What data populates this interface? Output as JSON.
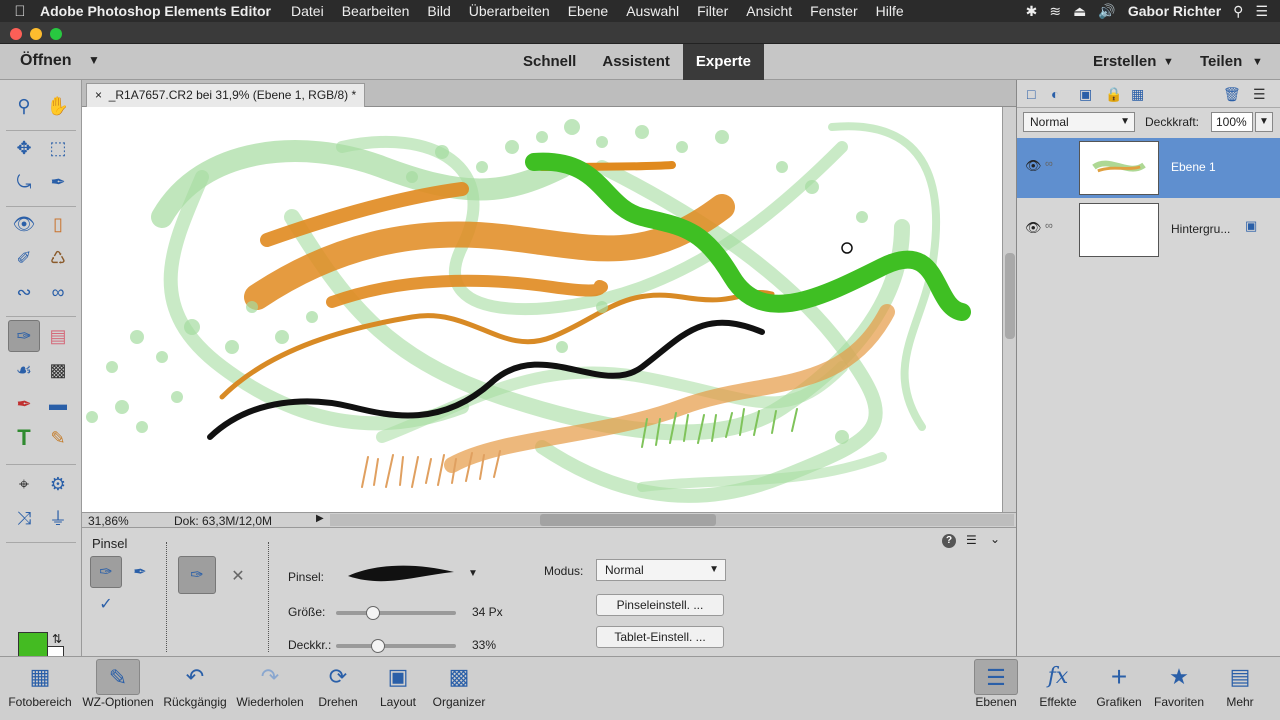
{
  "menubar": {
    "app_name": "Adobe Photoshop Elements Editor",
    "items": [
      "Datei",
      "Bearbeiten",
      "Bild",
      "Überarbeiten",
      "Ebene",
      "Auswahl",
      "Filter",
      "Ansicht",
      "Fenster",
      "Hilfe"
    ],
    "user": "Gabor Richter"
  },
  "modebar": {
    "open_label": "Öffnen",
    "modes": [
      "Schnell",
      "Assistent",
      "Experte"
    ],
    "active_mode": "Experte",
    "create_label": "Erstellen",
    "share_label": "Teilen"
  },
  "document": {
    "tab_title": "_R1A7657.CR2 bei 31,9% (Ebene 1, RGB/8) *",
    "zoom": "31,86%",
    "doc_size": "Dok: 63,3M/12,0M"
  },
  "layers_panel": {
    "blend_mode": "Normal",
    "opacity_label": "Deckkraft:",
    "opacity_value": "100%",
    "layers": [
      {
        "name": "Ebene 1",
        "selected": true
      },
      {
        "name": "Hintergru...",
        "selected": false
      }
    ]
  },
  "tool_options": {
    "tool_name": "Pinsel",
    "brush_label": "Pinsel:",
    "size_label": "Größe:",
    "size_value": "34 Px",
    "size_fraction": 0.28,
    "opacity_label": "Deckkr.:",
    "opacity_value": "33%",
    "opacity_fraction": 0.33,
    "mode_label": "Modus:",
    "mode_value": "Normal",
    "brush_settings_button": "Pinseleinstell. ...",
    "tablet_settings_button": "Tablet-Einstell. ..."
  },
  "colors": {
    "foreground": "#44bb22",
    "background": "#ffffff",
    "selection_blue": "#5f8fcf"
  },
  "taskbar": {
    "left": [
      "Fotobereich",
      "WZ-Optionen",
      "Rückgängig",
      "Wiederholen",
      "Drehen",
      "Layout",
      "Organizer"
    ],
    "right": [
      "Ebenen",
      "Effekte",
      "Grafiken",
      "Favoriten",
      "Mehr"
    ]
  }
}
